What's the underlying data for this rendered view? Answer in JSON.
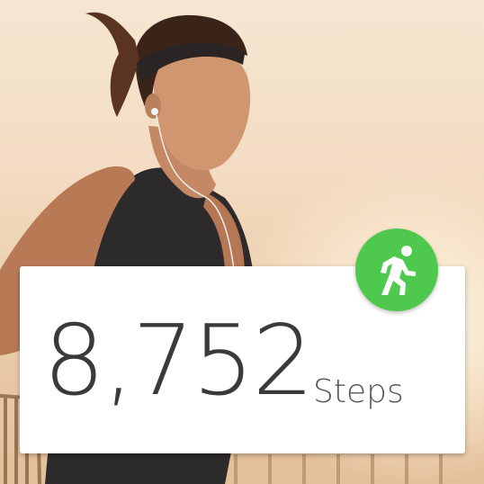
{
  "activity": {
    "step_count": "8,752",
    "unit_label": "Steps",
    "icon": "running-person-icon",
    "accent_color": "#4fc94d"
  }
}
